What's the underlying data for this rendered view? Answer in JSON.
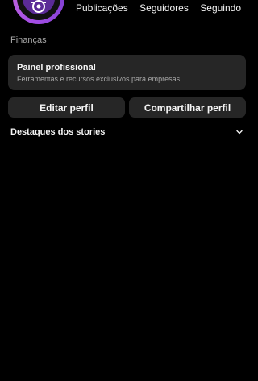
{
  "profile": {
    "category": "Finanças"
  },
  "stats": [
    {
      "label": "Publicações"
    },
    {
      "label": "Seguidores"
    },
    {
      "label": "Seguindo"
    }
  ],
  "pro_dashboard": {
    "title": "Painel profissional",
    "subtitle": "Ferramentas e recursos exclusivos para empresas."
  },
  "actions": {
    "edit_label": "Editar perfil",
    "share_label": "Compartilhar perfil"
  },
  "highlights": {
    "title": "Destaques dos stories",
    "toggle_icon": "chevron-down-icon"
  },
  "colors": {
    "background": "#000000",
    "card": "#262626",
    "text_primary": "#f5f5f5",
    "text_secondary": "#a8a8a8",
    "avatar_ring": "#a64fe6"
  }
}
